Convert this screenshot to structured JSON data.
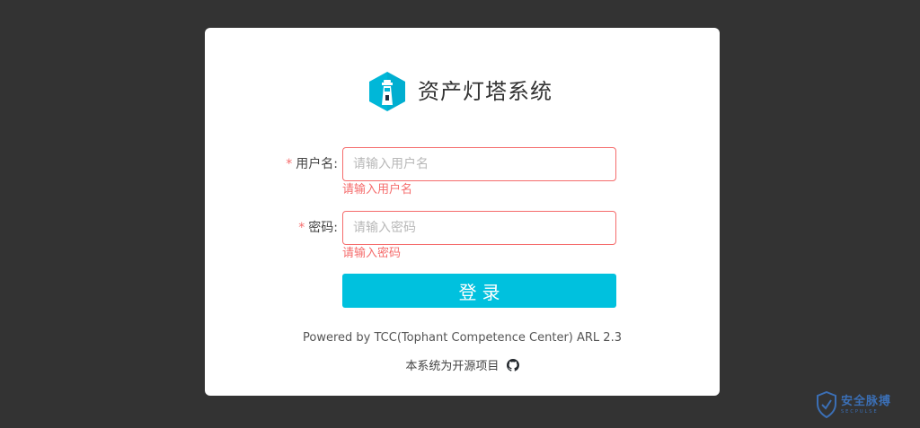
{
  "app": {
    "title": "资产灯塔系统"
  },
  "form": {
    "username": {
      "required_mark": "*",
      "label": "用户名:",
      "placeholder": "请输入用户名",
      "value": "",
      "error": "请输入用户名"
    },
    "password": {
      "required_mark": "*",
      "label": "密码:",
      "placeholder": "请输入密码",
      "value": "",
      "error": "请输入密码"
    },
    "login_label": "登录"
  },
  "footer": {
    "powered_by": "Powered by TCC(Tophant Competence Center) ARL 2.3",
    "open_source": "本系统为开源项目"
  },
  "icons": {
    "logo": "lighthouse-logo-icon",
    "github": "github-icon",
    "watermark": "shield-icon"
  },
  "watermark": {
    "main": "安全脉搏",
    "sub": "SECPULSE"
  },
  "colors": {
    "background": "#333333",
    "card": "#ffffff",
    "accent": "#00c1de",
    "error": "#f56c6c"
  }
}
